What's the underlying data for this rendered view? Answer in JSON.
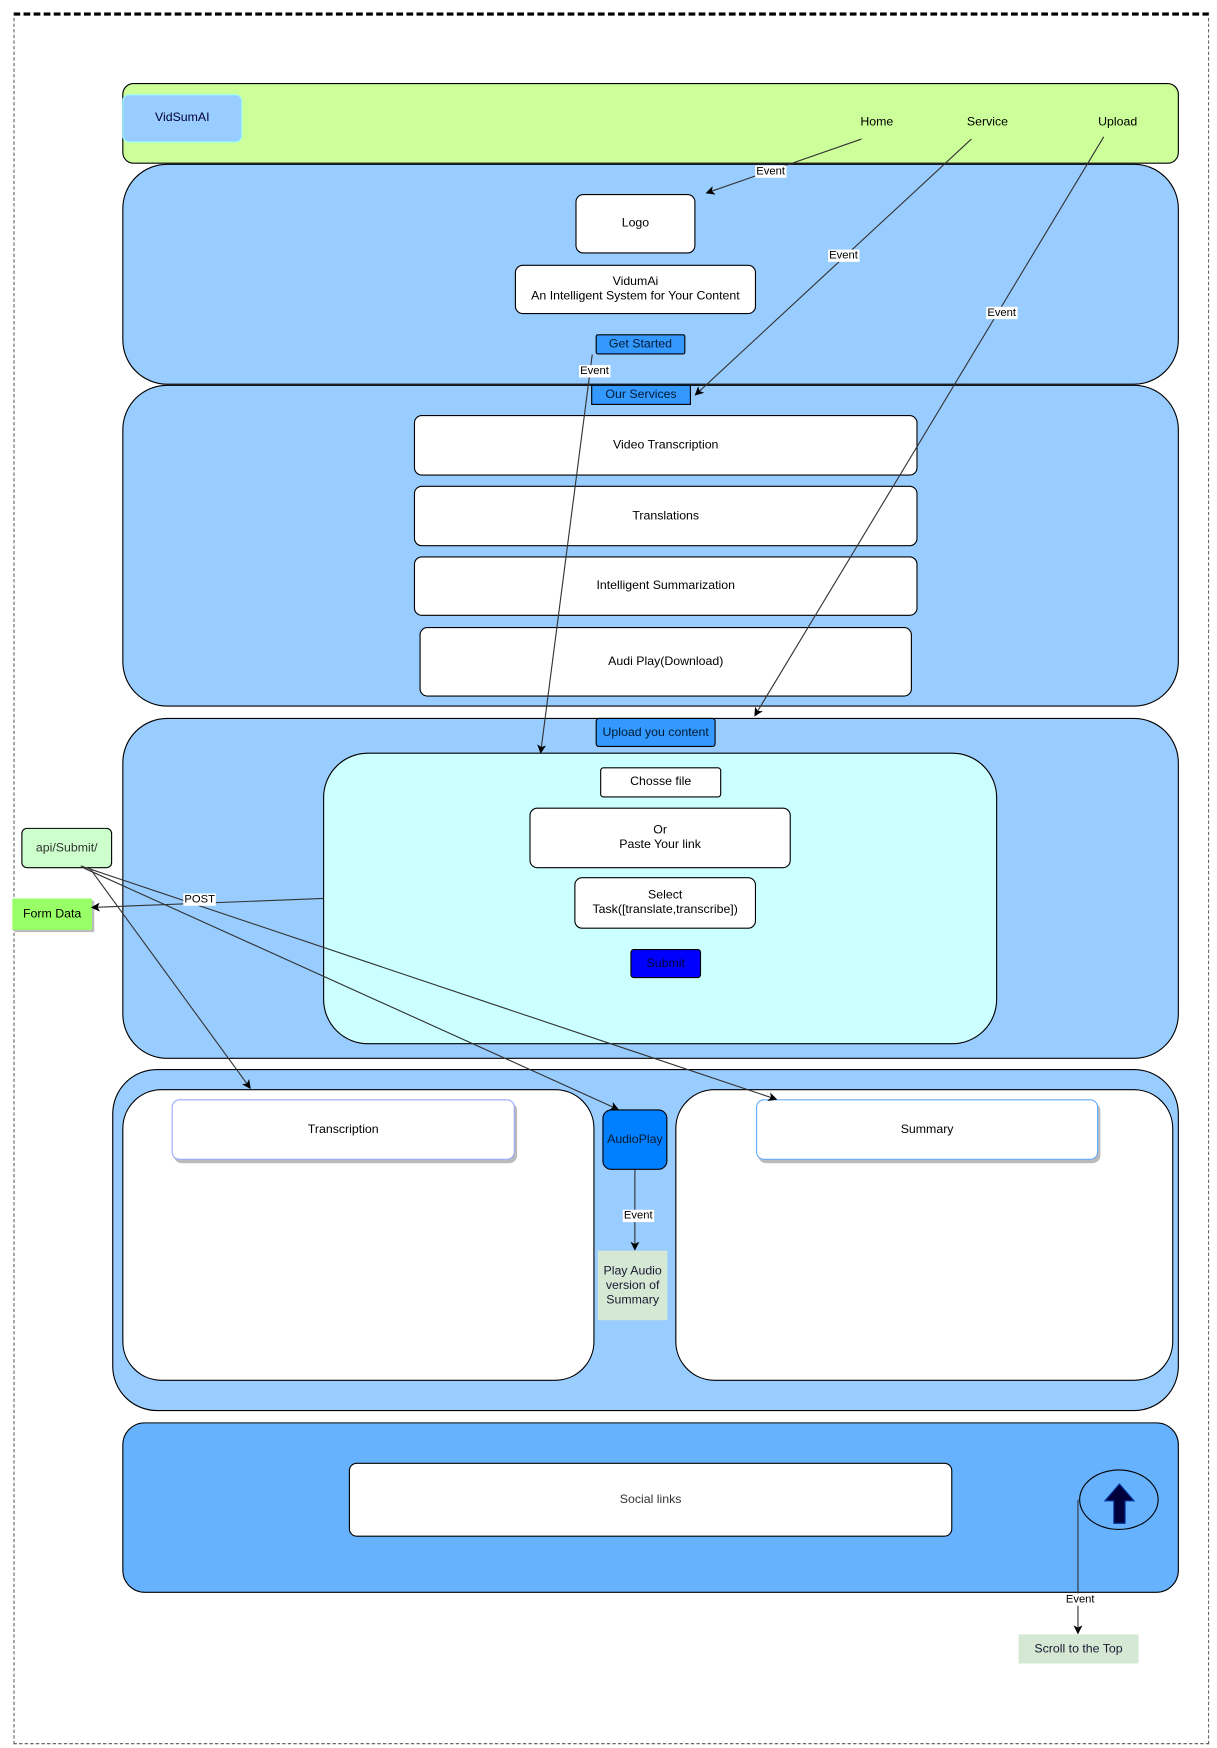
{
  "header": {
    "brand": "VidSumAI",
    "nav": [
      "Home",
      "Service",
      "Upload"
    ]
  },
  "hero": {
    "logo": "Logo",
    "tagline": "VidumAi\nAn Intelligent System for Your Content",
    "cta": "Get Started"
  },
  "services": {
    "title": "Our Services",
    "items": [
      "Video Transcription",
      "Translations",
      "Intelligent Summarization",
      "Audi Play(Download)"
    ]
  },
  "upload": {
    "title": "Upload you content",
    "choose_file": "Chosse file",
    "paste_link": "Or\nPaste Your link",
    "select_task": "Select\nTask([translate,transcribe])",
    "submit": "Submit"
  },
  "api": {
    "endpoint": "api/Submit/",
    "form_data": "Form Data",
    "post_label": "POST"
  },
  "results": {
    "transcription": "Transcription",
    "summary": "Summary",
    "audio_play": "AudioPlay",
    "play_audio": "Play Audio version of Summary"
  },
  "footer": {
    "social": "Social links",
    "scroll_top": "Scroll to the Top"
  },
  "edges": {
    "event": "Event"
  },
  "colors": {
    "header": "#ccff99",
    "section": "#99ccff",
    "upload_inner": "#ccffff",
    "footer": "#66b2ff",
    "button": "#3399ff",
    "submit": "#0000ff",
    "audio": "#007fff",
    "note": "#d5e8d4"
  }
}
